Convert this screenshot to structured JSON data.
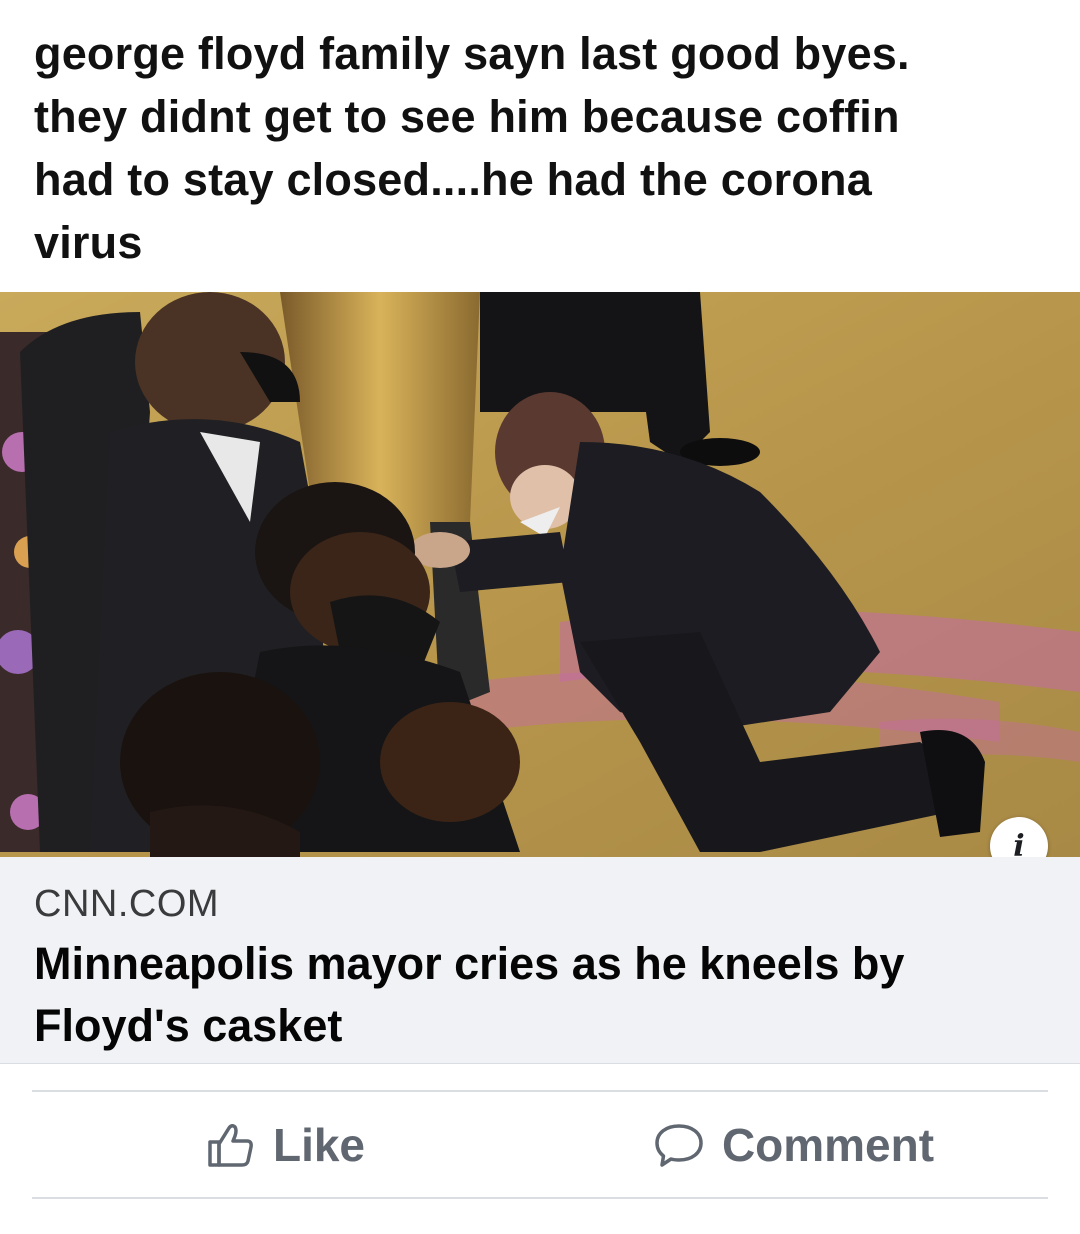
{
  "post": {
    "text": "george floyd family sayn last good byes.\nthey didnt get to see  him because coffin\nhad to stay closed....he had the corona\nvirus"
  },
  "link_card": {
    "info_icon": "i",
    "domain": "CNN.COM",
    "title": "Minneapolis mayor cries as he kneels by Floyd's casket"
  },
  "actions": {
    "like_label": "Like",
    "like_icon": "thumbs-up-icon",
    "comment_label": "Comment",
    "comment_icon": "speech-bubble-icon"
  },
  "colors": {
    "card_footer_bg": "#f0f2f5",
    "action_text": "#606770",
    "divider": "#dadde1"
  }
}
